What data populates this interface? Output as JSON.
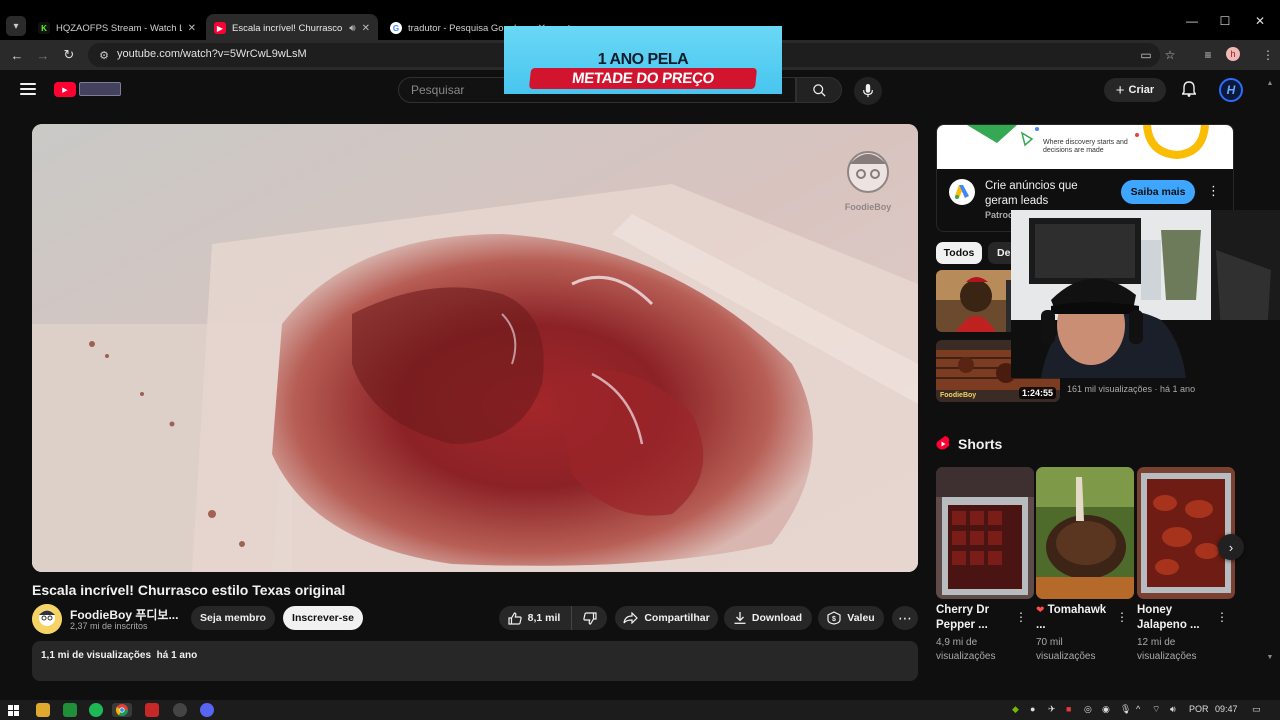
{
  "browser": {
    "tabs": [
      {
        "title": "HQZAOFPS Stream - Watch Live",
        "active": false
      },
      {
        "title": "Escala incrível! Churrasco e",
        "active": true
      },
      {
        "title": "tradutor - Pesquisa Google",
        "active": false
      }
    ],
    "url": "youtube.com/watch?v=5WrCwL9wLsM",
    "profile_initial": "h"
  },
  "masthead": {
    "search_placeholder": "Pesquisar",
    "create_label": "Criar",
    "avatar_letter": "H"
  },
  "promo": {
    "line1": "1 ANO PELA",
    "line2": "METADE DO PREÇO"
  },
  "video": {
    "title": "Escala incrível! Churrasco estilo Texas original",
    "watermark": "FoodieBoy",
    "channel_name": "FoodieBoy 푸디보...",
    "subscribers": "2,37 mi de inscritos",
    "join_label": "Seja membro",
    "subscribe_label": "Inscrever-se",
    "likes": "8,1 mil",
    "share_label": "Compartilhar",
    "download_label": "Download",
    "thanks_label": "Valeu",
    "stats": "1,1 mi de visualizações  há 1 ano"
  },
  "ad": {
    "banner_text": "Where discovery starts and decisions are made",
    "title": "Crie anúncios que geram leads",
    "sponsor": "Patroc",
    "cta": "Saiba mais"
  },
  "chips": [
    {
      "label": "Todos",
      "active": true
    },
    {
      "label": "De",
      "active": false
    }
  ],
  "recommendations": [
    {
      "duration": ""
    },
    {
      "duration": "1:24:55",
      "meta": "161 mil visualizações · há 1 ano"
    }
  ],
  "shorts": {
    "heading": "Shorts",
    "items": [
      {
        "title": "Cherry Dr Pepper ...",
        "views": "4,9 mi de visualizações"
      },
      {
        "title": "Tomahawk ...",
        "views": "70 mil visualizações"
      },
      {
        "title": "Honey Jalapeno ...",
        "views": "12 mi de visualizações"
      }
    ]
  },
  "taskbar": {
    "language": "POR",
    "time": "09:47"
  },
  "colors": {
    "brand_red": "#ff0033",
    "accent_blue": "#3ea6ff",
    "page_bg": "#0f0f0f"
  }
}
